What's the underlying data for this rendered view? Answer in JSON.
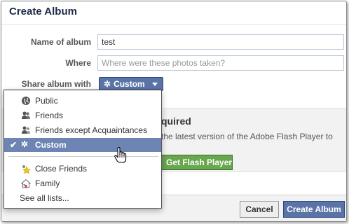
{
  "dialog": {
    "title": "Create Album"
  },
  "form": {
    "name_label": "Name of album",
    "name_value": "test",
    "where_label": "Where",
    "where_placeholder": "Where were these photos taken?",
    "share_label": "Share album with"
  },
  "share_button": {
    "label": "Custom",
    "icon": "gear-icon"
  },
  "flash": {
    "title_visible": "quired",
    "text_visible": "the latest version of the Adobe Flash Player to",
    "button_label": "Get Flash Player"
  },
  "footer": {
    "cancel_label": "Cancel",
    "create_label": "Create Album"
  },
  "dropdown": {
    "items": [
      {
        "label": "Public",
        "icon": "globe-icon"
      },
      {
        "label": "Friends",
        "icon": "friends-icon"
      },
      {
        "label": "Friends except Acquaintances",
        "icon": "friends-except-icon"
      },
      {
        "label": "Custom",
        "icon": "gear-icon",
        "selected": true
      },
      {
        "label": "Close Friends",
        "icon": "star-icon"
      },
      {
        "label": "Family",
        "icon": "house-icon"
      },
      {
        "label": "See all lists...",
        "icon": ""
      }
    ]
  },
  "colors": {
    "brand_blue": "#5b74a8",
    "selected_bg": "#6d84b4",
    "flash_green": "#69a74e"
  }
}
